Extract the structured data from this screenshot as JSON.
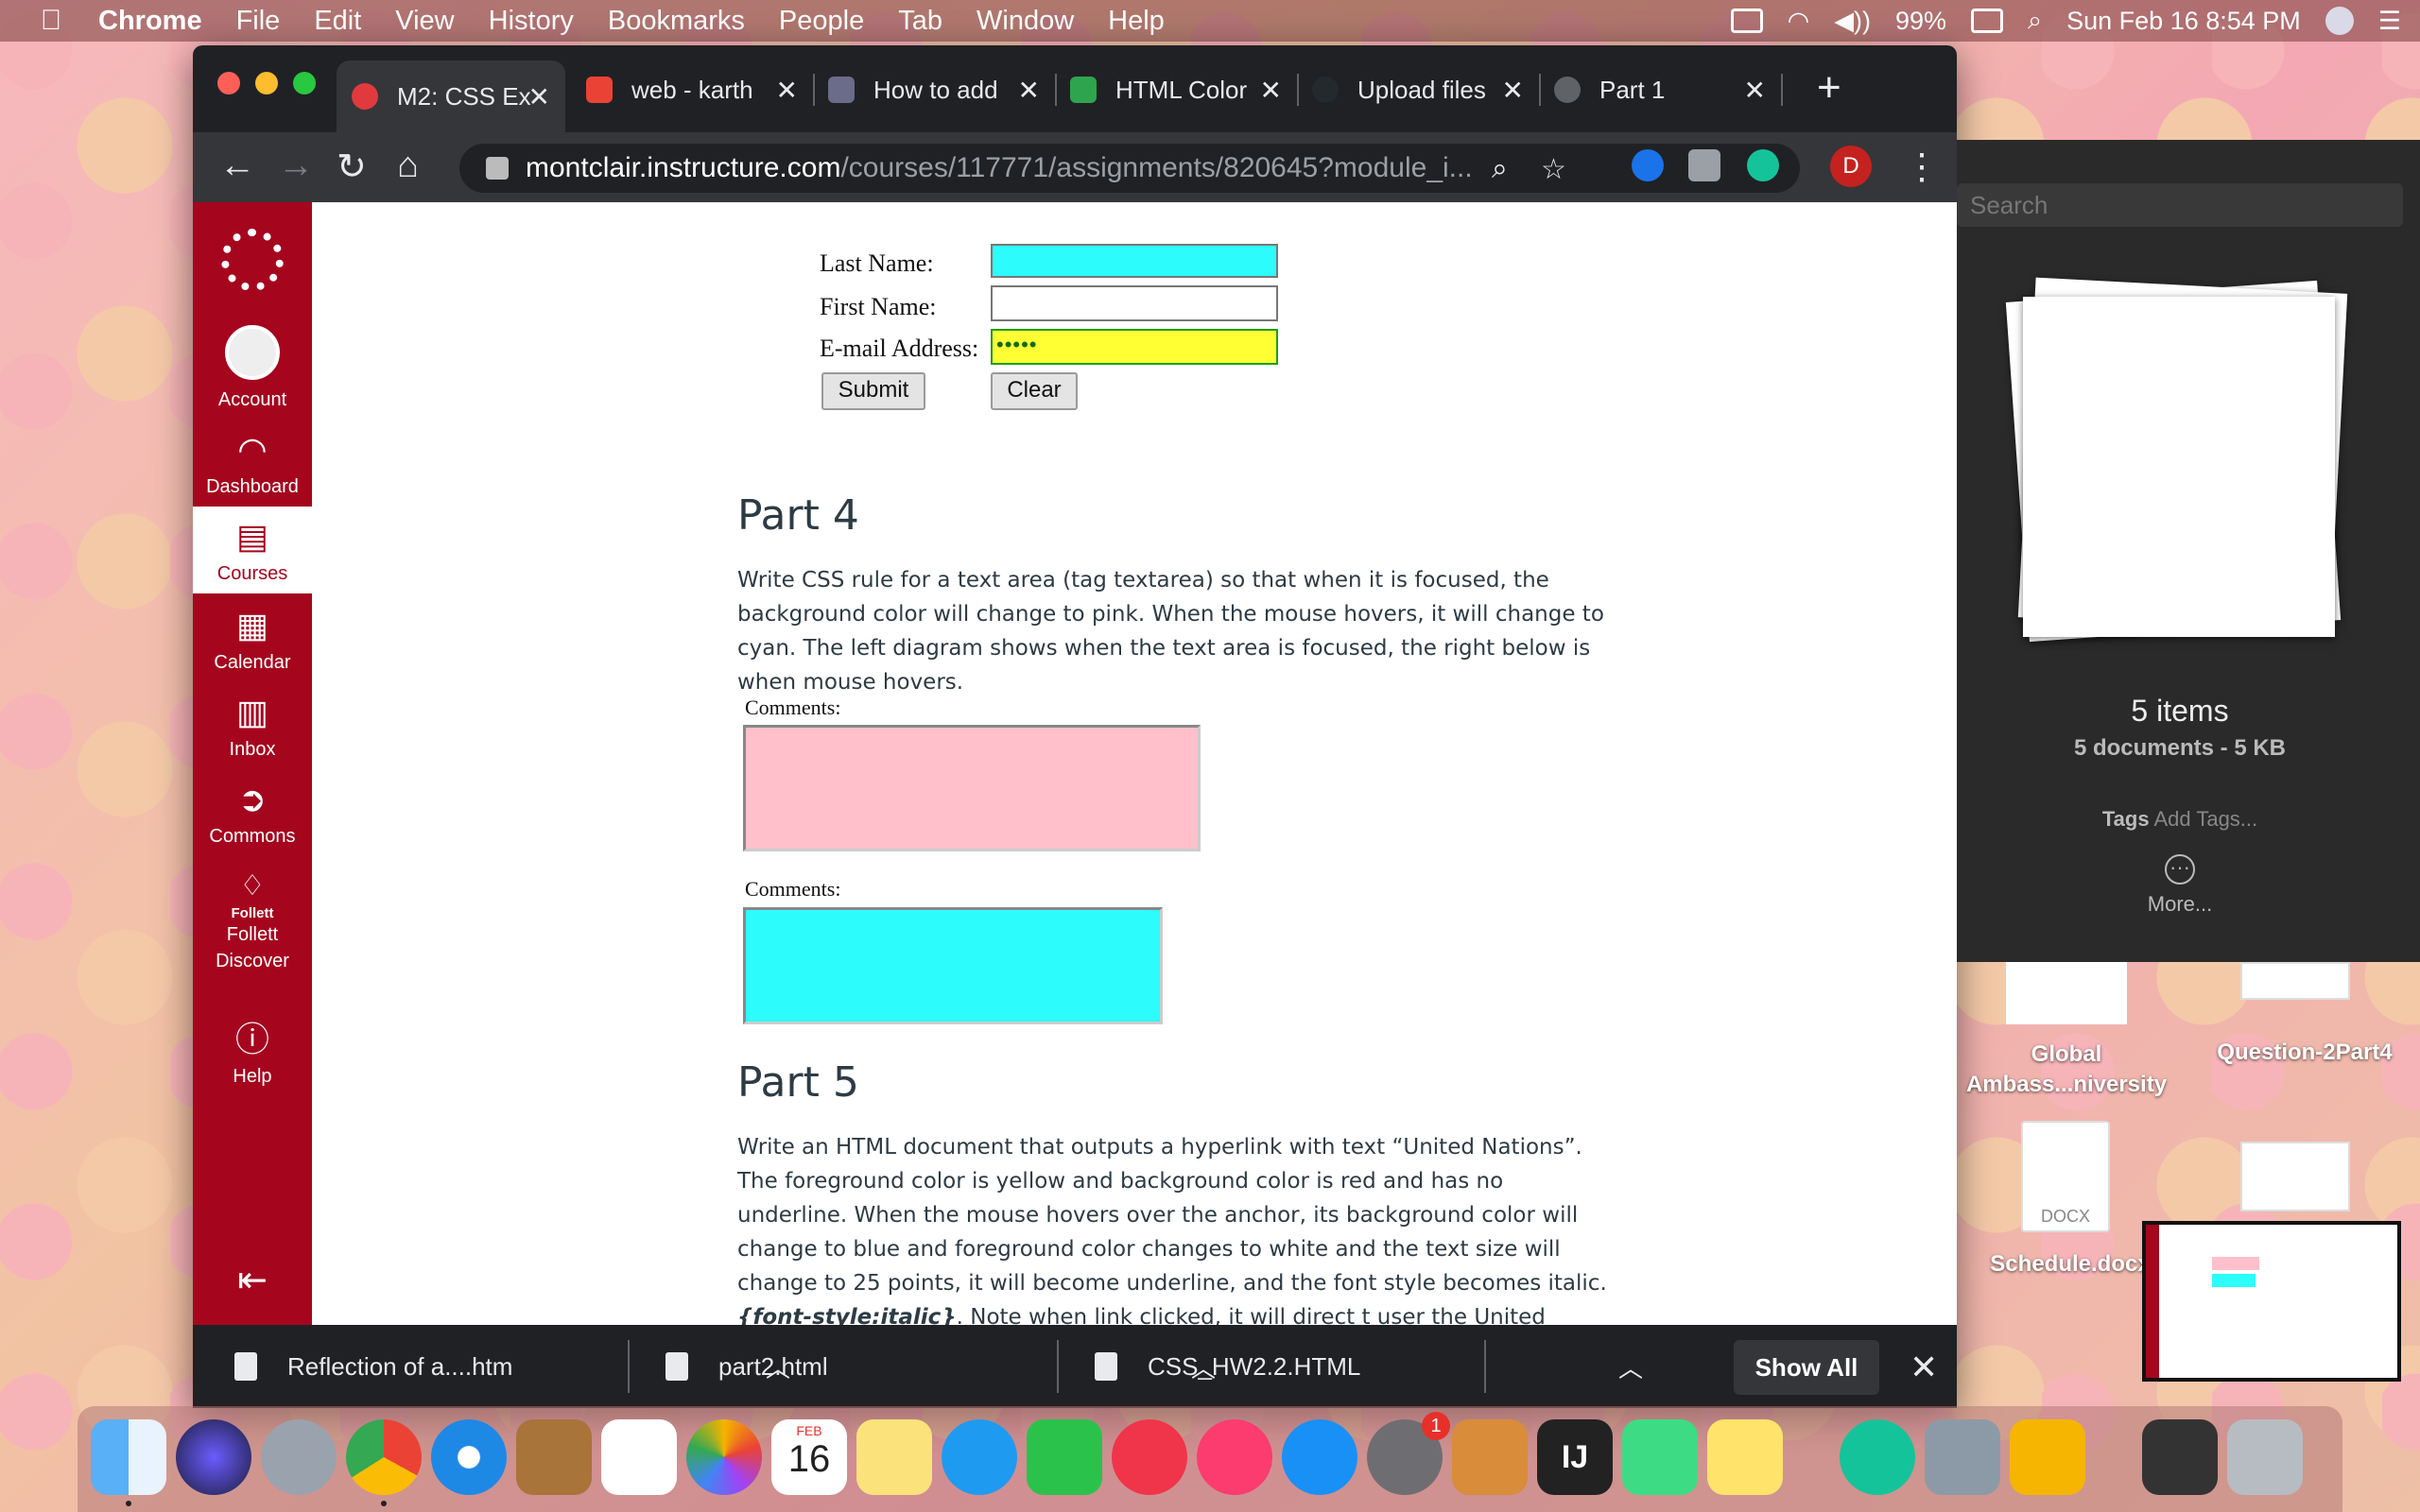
{
  "menubar": {
    "apple": "",
    "items": [
      "Chrome",
      "File",
      "Edit",
      "View",
      "History",
      "Bookmarks",
      "People",
      "Tab",
      "Window",
      "Help"
    ],
    "battery": "99%",
    "datetime": "Sun Feb 16  8:54 PM"
  },
  "browser": {
    "tabs": [
      {
        "title": "M2: CSS Ex",
        "favicon_color": "#e03a3e",
        "active": true
      },
      {
        "title": "web - karth",
        "favicon_color": "#ea4335",
        "active": false
      },
      {
        "title": "How to add",
        "favicon_color": "#6b6b8a",
        "active": false
      },
      {
        "title": "HTML Color",
        "favicon_color": "#2ea44f",
        "active": false
      },
      {
        "title": "Upload files",
        "favicon_color": "#24292e",
        "active": false
      },
      {
        "title": "Part 1",
        "favicon_color": "#5f6368",
        "active": false
      }
    ],
    "url_host": "montclair.instructure.com",
    "url_path": "/courses/117771/assignments/820645?module_i...",
    "profile_initial": "D"
  },
  "canvas_nav": {
    "items": [
      {
        "label": "Account",
        "icon": "user-icon"
      },
      {
        "label": "Dashboard",
        "icon": "dashboard-icon"
      },
      {
        "label": "Courses",
        "icon": "book-icon",
        "active": true
      },
      {
        "label": "Calendar",
        "icon": "calendar-icon"
      },
      {
        "label": "Inbox",
        "icon": "inbox-icon"
      },
      {
        "label": "Commons",
        "icon": "commons-icon"
      },
      {
        "label": "Follett",
        "icon": "follett-icon"
      },
      {
        "label": "Help",
        "icon": "help-icon"
      }
    ],
    "follett_sub": "Follett\nDiscover"
  },
  "form": {
    "last_name_label": "Last Name:",
    "first_name_label": "First Name:",
    "email_label": "E-mail Address:",
    "email_value": "•••••",
    "submit_label": "Submit",
    "clear_label": "Clear",
    "colors": {
      "last_name_bg": "#2dfcfc",
      "email_bg": "#ffff33",
      "email_border": "#1e9e1e"
    }
  },
  "part4": {
    "heading": "Part 4",
    "text": "Write CSS rule for a text area (tag textarea) so that when it is focused, the background color will change to pink. When the mouse hovers, it will change to cyan. The left diagram shows when the text area is focused, the right below is when mouse hovers.",
    "comments_label_1": "Comments:",
    "comments_label_2": "Comments:",
    "colors": {
      "focused": "#ffc0cb",
      "hover": "#2dfcfc"
    }
  },
  "part5": {
    "heading": "Part 5",
    "text_before": "Write an HTML document that outputs a hyperlink with text “United Nations”. The foreground color is yellow and background color is red and has no underline. When the mouse hovers over the anchor, its background color will change to blue and foreground color changes to white and the text size will change to 25 points, it will become underline, and the font style becomes italic. ",
    "code": "{font-style:italic}",
    "text_after": ". Note when link clicked, it will direct t user the United Nations website."
  },
  "downloads": {
    "items": [
      "Reflection of a....htm",
      "part2.html",
      "CSS_HW2.2.HTML"
    ],
    "show_all": "Show All"
  },
  "quicklook": {
    "search_placeholder": "Search",
    "count": "5 items",
    "summary": "5 documents - 5 KB",
    "tags_label": "Tags",
    "tags_add": "Add Tags...",
    "more": "More..."
  },
  "desktop": {
    "icons": [
      "Global Ambass...niversity",
      "Question-2Part4",
      "Schedule.docx"
    ],
    "docx_label": "DOCX"
  },
  "dock": {
    "calendar_month": "FEB",
    "calendar_day": "16",
    "prefs_badge": "1"
  }
}
